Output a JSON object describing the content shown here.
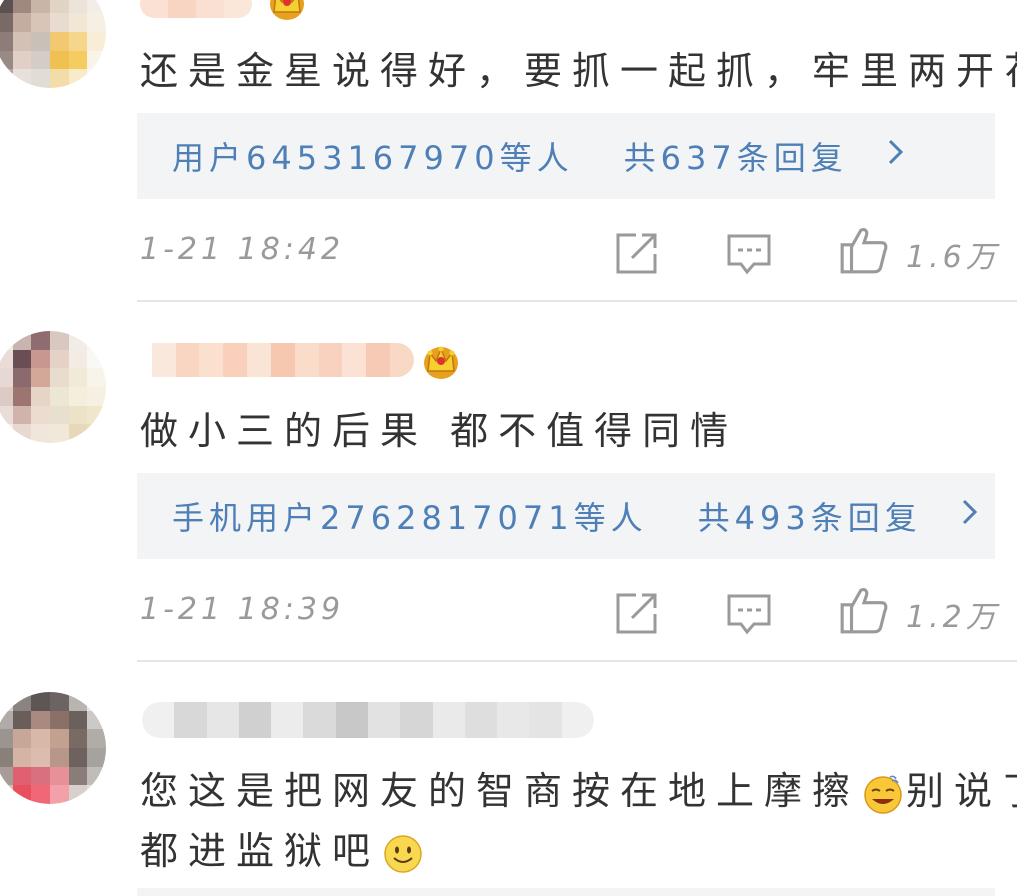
{
  "comments": [
    {
      "text": "还是金星说得好，要抓一起抓，牢里两开花",
      "replies_users": "用户6453167970等人",
      "replies_count": "共637条回复",
      "time": "1-21  18:42",
      "likes": "1.6万"
    },
    {
      "text": "做小三的后果 都不值得同情",
      "replies_users": "手机用户2762817071等人",
      "replies_count": "共493条回复",
      "time": "1-21  18:39",
      "likes": "1.2万"
    },
    {
      "text_line1_a": "您这是把网友的智商按在地上摩擦",
      "text_line1_b": "别说了",
      "text_line2": "都进监狱吧"
    }
  ],
  "icons": {
    "share": "share-icon",
    "comment": "comment-icon",
    "like": "thumbs-up-icon",
    "chevron": "chevron-right-icon",
    "crown": "crown-icon",
    "emoji_sweat": "sweat-smile-emoji",
    "emoji_smile": "smile-emoji"
  },
  "colors": {
    "link_blue": "#4e7fb6",
    "meta_gray": "#9a9a9a",
    "reply_bg": "#f3f4f6"
  }
}
